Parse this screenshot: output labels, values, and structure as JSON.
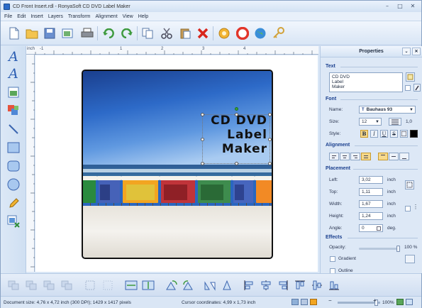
{
  "window": {
    "title": "CD Front Insert.rdl - RonyaSoft CD DVD Label Maker"
  },
  "menu": [
    "File",
    "Edit",
    "Insert",
    "Layers",
    "Transform",
    "Alignment",
    "View",
    "Help"
  ],
  "toolbar": {
    "icons": [
      "new-icon",
      "open-icon",
      "save-icon",
      "export-icon",
      "print-icon",
      "undo-icon",
      "redo-icon",
      "copy-icon",
      "cut-icon",
      "paste-icon",
      "delete-icon",
      "settings-icon",
      "help-icon",
      "web-icon",
      "key-icon"
    ]
  },
  "left_tools": [
    "text-icon",
    "curved-text-icon",
    "image-icon",
    "layers-icon",
    "line-icon",
    "rectangle-icon",
    "rounded-rectangle-icon",
    "ellipse-icon",
    "pencil-icon",
    "image-frame-icon"
  ],
  "ruler": {
    "unit": "inch",
    "labels": [
      "-1",
      "1",
      "2",
      "3",
      "4"
    ]
  },
  "label": {
    "lines": [
      "CD DVD",
      "Label",
      "Maker"
    ]
  },
  "properties": {
    "header": "Properties",
    "text_section": "Text",
    "text_value": [
      "CD DVD",
      "Label",
      "Maker"
    ],
    "font_section": "Font",
    "name_label": "Name:",
    "font_name": "Bauhaus 93",
    "size_label": "Size:",
    "size_value": "12",
    "line_spacing": "1,0",
    "style_label": "Style:",
    "bold": "B",
    "italic": "I",
    "underline": "U",
    "strike": "S",
    "alignment_section": "Alignment",
    "placement_section": "Placement",
    "left_label": "Left:",
    "left_value": "3,02",
    "top_label": "Top:",
    "top_value": "1,11",
    "width_label": "Width:",
    "width_value": "1,67",
    "height_label": "Height:",
    "height_value": "1,24",
    "angle_label": "Angle:",
    "angle_value": "0",
    "unit_inch": "inch",
    "unit_deg": "deg.",
    "effects_section": "Effects",
    "opacity_label": "Opacity:",
    "opacity_value": "100 %",
    "opacity": 1.0,
    "gradient_label": "Gradient",
    "outline_label": "Outline"
  },
  "status": {
    "document_size": "Document size: 4,76 x 4,72 inch (300 DPI); 1429 x 1417 pixels",
    "cursor": "Cursor coordinates: 4,99 x 1,73 inch",
    "zoom": "100%"
  },
  "colors": {
    "accent": "#1a3f8e",
    "highlight": "#f7d98b",
    "font_color": "#000000"
  }
}
